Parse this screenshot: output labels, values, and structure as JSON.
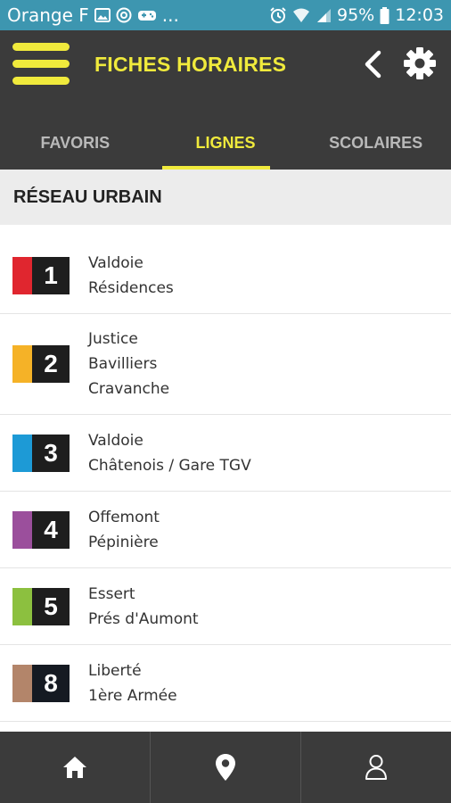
{
  "status_bar": {
    "carrier": "Orange F",
    "dots": "...",
    "battery": "95%",
    "time": "12:03"
  },
  "header": {
    "title": "FICHES HORAIRES"
  },
  "tabs": [
    {
      "label": "FAVORIS",
      "active": false
    },
    {
      "label": "LIGNES",
      "active": true
    },
    {
      "label": "SCOLAIRES",
      "active": false
    }
  ],
  "section": {
    "title": "RÉSEAU URBAIN"
  },
  "lines": [
    {
      "number": "1",
      "color": "#e0262f",
      "stops": [
        "Valdoie",
        "Résidences"
      ]
    },
    {
      "number": "2",
      "color": "#f5b227",
      "stops": [
        "Justice",
        "Bavilliers",
        "Cravanche"
      ]
    },
    {
      "number": "3",
      "color": "#1d9ad6",
      "stops": [
        "Valdoie",
        "Châtenois / Gare TGV"
      ]
    },
    {
      "number": "4",
      "color": "#9b4f9c",
      "stops": [
        "Offemont",
        "Pépinière"
      ]
    },
    {
      "number": "5",
      "color": "#8cc03f",
      "stops": [
        "Essert",
        "Prés d'Aumont"
      ]
    },
    {
      "number": "8",
      "color": "#b3856a",
      "stops": [
        "Liberté",
        "1ère Armée"
      ]
    }
  ],
  "bottom_nav": [
    {
      "icon": "home-icon"
    },
    {
      "icon": "map-pin-icon"
    },
    {
      "icon": "user-icon"
    }
  ],
  "colors": {
    "accent": "#f0ea3c",
    "header_bg": "#3b3b3b",
    "status_bar_bg": "#3d96b0"
  }
}
